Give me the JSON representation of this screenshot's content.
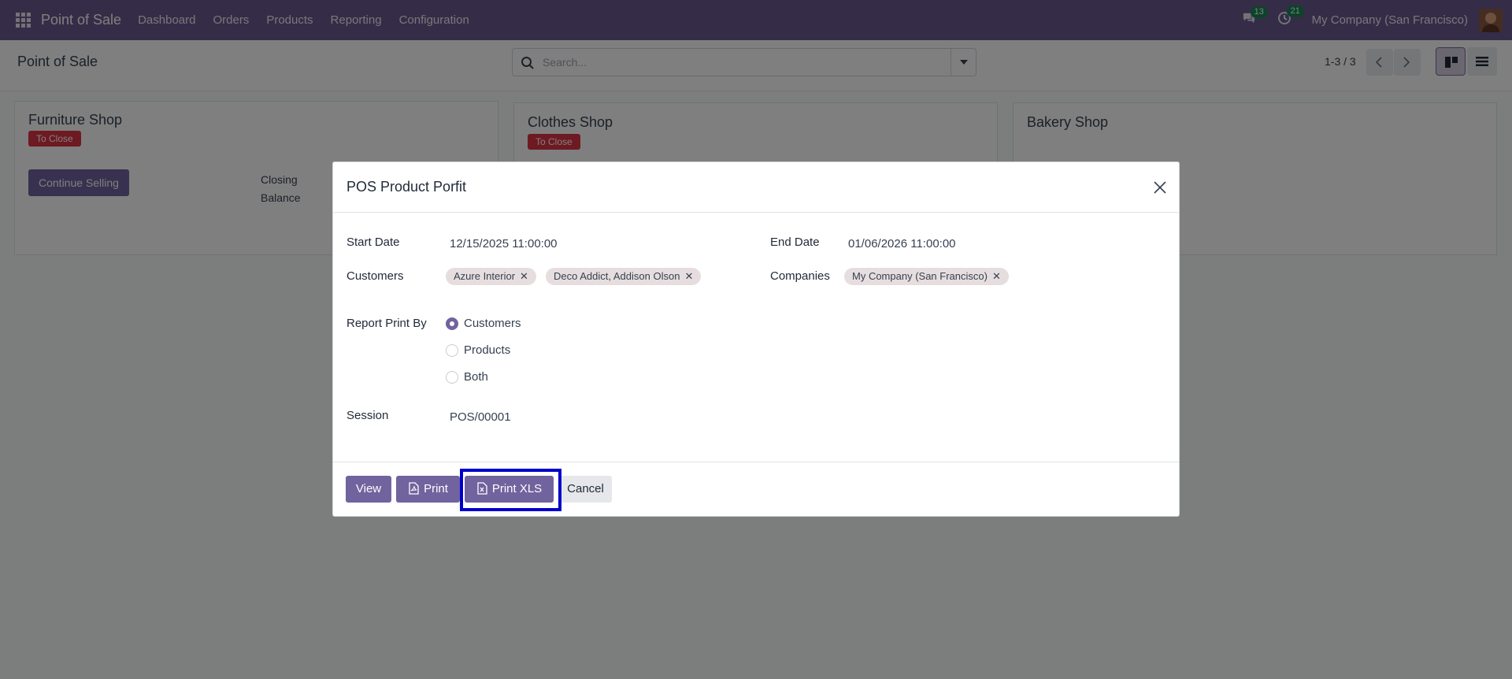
{
  "navbar": {
    "brand": "Point of Sale",
    "menu": [
      "Dashboard",
      "Orders",
      "Products",
      "Reporting",
      "Configuration"
    ],
    "messages_count": "13",
    "activities_count": "21",
    "company": "My Company (San Francisco)",
    "accent_color": "#6b5a8e"
  },
  "control_panel": {
    "title": "Point of Sale",
    "search_placeholder": "Search...",
    "pager": "1-3 / 3"
  },
  "cards": [
    {
      "title": "Furniture Shop",
      "badge": "To Close",
      "button": "Continue Selling",
      "label": "Closing Balance"
    },
    {
      "title": "Clothes Shop",
      "badge": "To Close"
    },
    {
      "title": "Bakery Shop"
    }
  ],
  "modal": {
    "title": "POS Product Porfit",
    "start_date_label": "Start Date",
    "start_date": "12/15/2025 11:00:00",
    "end_date_label": "End Date",
    "end_date": "01/06/2026 11:00:00",
    "customers_label": "Customers",
    "customers": [
      "Azure Interior",
      "Deco Addict, Addison Olson"
    ],
    "companies_label": "Companies",
    "companies": [
      "My Company (San Francisco)"
    ],
    "report_print_by_label": "Report Print By",
    "report_options": [
      "Customers",
      "Products",
      "Both"
    ],
    "report_selected": "Customers",
    "session_label": "Session",
    "session": "POS/00001",
    "buttons": {
      "view": "View",
      "print": "Print",
      "print_xls": "Print XLS",
      "cancel": "Cancel"
    }
  }
}
